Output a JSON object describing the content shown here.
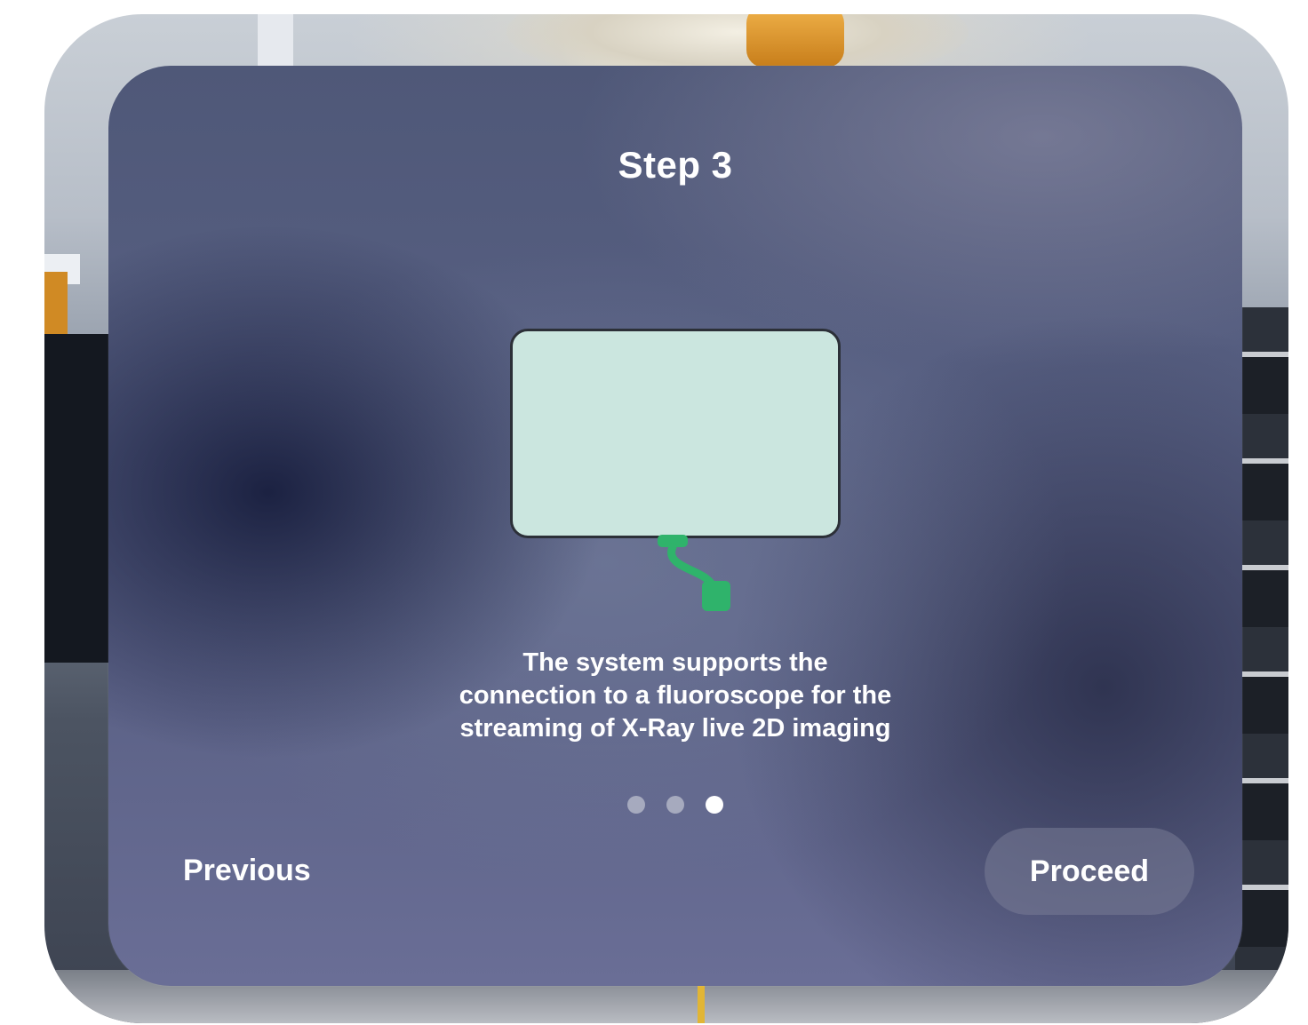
{
  "dialog": {
    "title": "Step 3",
    "description": "The system supports the connection to a fluoroscope for the streaming of X-Ray live 2D imaging",
    "illustration": "monitor-with-cable-icon",
    "pagination": {
      "total": 3,
      "current": 3
    },
    "previous_label": "Previous",
    "proceed_label": "Proceed"
  },
  "colors": {
    "screen_fill": "#cbe6df",
    "cable_green": "#2fb36b",
    "text": "#ffffff"
  }
}
